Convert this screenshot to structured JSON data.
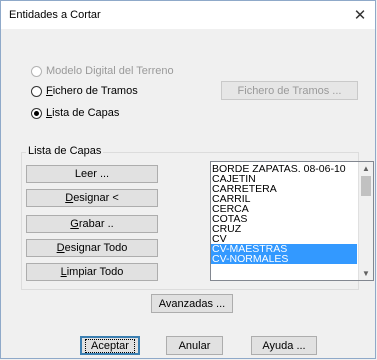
{
  "dialog": {
    "title": "Entidades a Cortar"
  },
  "options": {
    "modelo": {
      "label": "Modelo Digital del Terreno",
      "enabled": false,
      "checked": false
    },
    "fichero": {
      "label": "Fichero de Tramos",
      "checked": false
    },
    "lista": {
      "label": "Lista de Capas",
      "checked": true
    },
    "fichero_button": "Fichero de Tramos ..."
  },
  "group": {
    "label": "Lista de Capas",
    "buttons": {
      "leer": "Leer ...",
      "designar": "Designar <",
      "grabar": "Grabar ..",
      "designar_todo": "Designar Todo",
      "limpiar_todo": "Limpiar Todo"
    },
    "layers": [
      {
        "name": "BORDE ZAPATAS. 08-06-10",
        "selected": false
      },
      {
        "name": "CAJETIN",
        "selected": false
      },
      {
        "name": "CARRETERA",
        "selected": false
      },
      {
        "name": "CARRIL",
        "selected": false
      },
      {
        "name": "CERCA",
        "selected": false
      },
      {
        "name": "COTAS",
        "selected": false
      },
      {
        "name": "CRUZ",
        "selected": false
      },
      {
        "name": "CV",
        "selected": false
      },
      {
        "name": "CV-MAESTRAS",
        "selected": true
      },
      {
        "name": "CV-NORMALES",
        "selected": true
      }
    ]
  },
  "buttons": {
    "avanzadas": "Avanzadas ...",
    "aceptar": "Aceptar",
    "anular": "Anular",
    "ayuda": "Ayuda ..."
  },
  "icons": {
    "close": "close-icon",
    "scroll_up": "chevron-up-icon",
    "scroll_down": "chevron-down-icon"
  }
}
